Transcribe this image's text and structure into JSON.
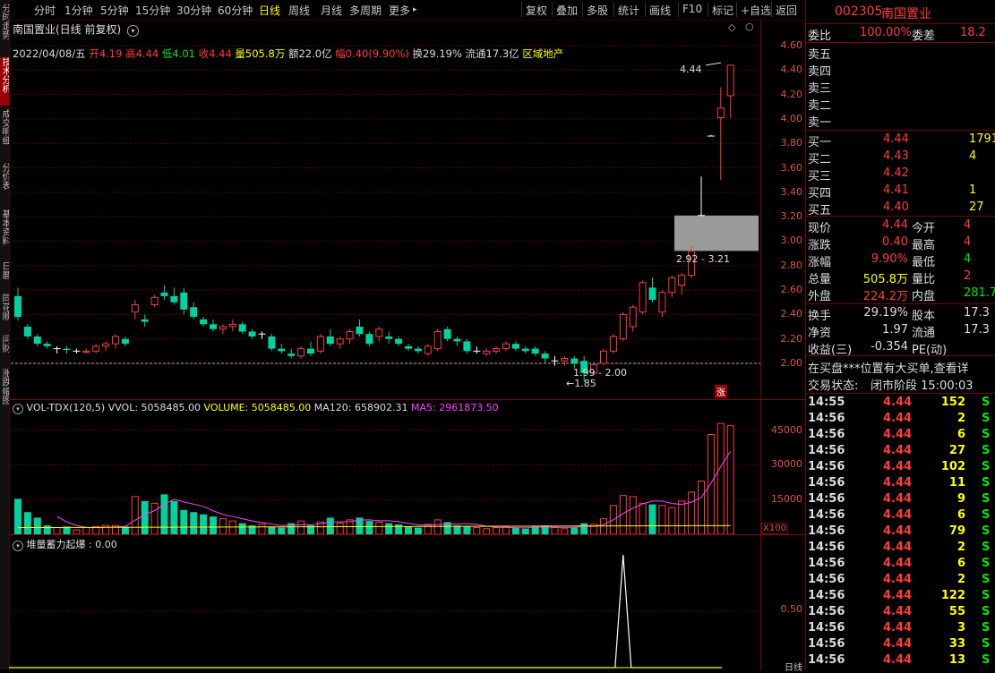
{
  "toolbar": {
    "periods": [
      "分时",
      "1分钟",
      "5分钟",
      "15分钟",
      "30分钟",
      "60分钟",
      "日线",
      "周线",
      "月线",
      "多周期",
      "更多"
    ],
    "active_period": "日线",
    "tools": [
      "复权",
      "叠加",
      "多股",
      "统计",
      "画线",
      "F10",
      "标记",
      "+自选",
      "返回"
    ]
  },
  "side_tabs": [
    "分时走势",
    "技术分析",
    "成交明细",
    "分价表",
    "基本资料",
    "日暦",
    "同花顺",
    "问财",
    "涨跌幅图"
  ],
  "chart": {
    "title": "南国置业(日线 前复权)",
    "date": "2022/04/08/五",
    "open_label": "开",
    "open": "4.19",
    "high_label": "高",
    "high": "4.44",
    "low_label": "低",
    "low": "4.01",
    "close_label": "收",
    "close": "4.44",
    "vol_label": "量",
    "vol": "505.8万",
    "amount_label": "额",
    "amount": "22.0亿",
    "change_label": "幅",
    "change": "0.40(9.90%)",
    "turnover_label": "换",
    "turnover": "29.19%",
    "float_label": "流通",
    "float": "17.3亿",
    "sector": "区域地产",
    "annot_high": "4.44",
    "annot_gap": "2.92 - 3.21",
    "annot_low_range": "1.99 - 2.00",
    "annot_low": "1.85",
    "limit_badge": "涨",
    "price_ticks": [
      "4.60",
      "4.40",
      "4.20",
      "4.00",
      "3.80",
      "3.60",
      "3.40",
      "3.20",
      "3.00",
      "2.80",
      "2.60",
      "2.40",
      "2.20",
      "2.00"
    ]
  },
  "volume": {
    "name": "VOL-TDX(120,5)",
    "vvol": "VVOL: 5058485.00",
    "volume": "VOLUME: 5058485.00",
    "ma120": "MA120: 658902.31",
    "ma5": "MA5: 2961873.50",
    "ticks": [
      "45000",
      "30000",
      "15000"
    ],
    "unit": "X100"
  },
  "indicator": {
    "title": "堆量蓄力起爆 : 0.00",
    "ticks": [
      "0.50"
    ],
    "bottom_label": "日线"
  },
  "chart_data": {
    "type": "candlestick",
    "ohlc": [
      [
        2.55,
        2.62,
        2.35,
        2.38
      ],
      [
        2.3,
        2.32,
        2.2,
        2.22
      ],
      [
        2.22,
        2.24,
        2.14,
        2.16
      ],
      [
        2.16,
        2.18,
        2.12,
        2.14
      ],
      [
        2.12,
        2.14,
        2.08,
        2.12
      ],
      [
        2.12,
        2.14,
        2.08,
        2.11
      ],
      [
        2.1,
        2.12,
        2.08,
        2.1
      ],
      [
        2.09,
        2.12,
        2.08,
        2.1
      ],
      [
        2.1,
        2.16,
        2.08,
        2.14
      ],
      [
        2.14,
        2.18,
        2.1,
        2.16
      ],
      [
        2.16,
        2.24,
        2.12,
        2.22
      ],
      [
        2.2,
        2.22,
        2.14,
        2.16
      ],
      [
        2.42,
        2.52,
        2.36,
        2.48
      ],
      [
        2.36,
        2.4,
        2.3,
        2.34
      ],
      [
        2.48,
        2.56,
        2.46,
        2.54
      ],
      [
        2.58,
        2.64,
        2.52,
        2.55
      ],
      [
        2.55,
        2.62,
        2.48,
        2.5
      ],
      [
        2.58,
        2.62,
        2.4,
        2.44
      ],
      [
        2.46,
        2.5,
        2.36,
        2.38
      ],
      [
        2.36,
        2.38,
        2.3,
        2.32
      ],
      [
        2.32,
        2.36,
        2.26,
        2.28
      ],
      [
        2.28,
        2.32,
        2.24,
        2.3
      ],
      [
        2.3,
        2.36,
        2.26,
        2.32
      ],
      [
        2.32,
        2.34,
        2.24,
        2.26
      ],
      [
        2.26,
        2.28,
        2.2,
        2.22
      ],
      [
        2.24,
        2.26,
        2.2,
        2.24
      ],
      [
        2.22,
        2.24,
        2.1,
        2.12
      ],
      [
        2.12,
        2.16,
        2.08,
        2.1
      ],
      [
        2.08,
        2.12,
        2.04,
        2.06
      ],
      [
        2.06,
        2.14,
        2.04,
        2.12
      ],
      [
        2.12,
        2.18,
        2.06,
        2.08
      ],
      [
        2.1,
        2.24,
        2.08,
        2.22
      ],
      [
        2.22,
        2.28,
        2.14,
        2.16
      ],
      [
        2.16,
        2.22,
        2.12,
        2.2
      ],
      [
        2.2,
        2.28,
        2.16,
        2.26
      ],
      [
        2.3,
        2.36,
        2.22,
        2.24
      ],
      [
        2.24,
        2.26,
        2.14,
        2.16
      ],
      [
        2.22,
        2.3,
        2.18,
        2.28
      ],
      [
        2.22,
        2.26,
        2.16,
        2.2
      ],
      [
        2.2,
        2.22,
        2.14,
        2.16
      ],
      [
        2.14,
        2.16,
        2.1,
        2.12
      ],
      [
        2.12,
        2.14,
        2.08,
        2.1
      ],
      [
        2.08,
        2.16,
        2.06,
        2.14
      ],
      [
        2.12,
        2.28,
        2.1,
        2.26
      ],
      [
        2.28,
        2.3,
        2.18,
        2.2
      ],
      [
        2.2,
        2.22,
        2.14,
        2.18
      ],
      [
        2.18,
        2.2,
        2.08,
        2.1
      ],
      [
        2.1,
        2.14,
        2.08,
        2.1
      ],
      [
        2.08,
        2.12,
        2.06,
        2.1
      ],
      [
        2.1,
        2.14,
        2.08,
        2.12
      ],
      [
        2.12,
        2.18,
        2.1,
        2.16
      ],
      [
        2.16,
        2.18,
        2.1,
        2.12
      ],
      [
        2.12,
        2.14,
        2.08,
        2.1
      ],
      [
        2.12,
        2.14,
        2.06,
        2.08
      ],
      [
        2.08,
        2.1,
        2.0,
        2.04
      ],
      [
        2.02,
        2.06,
        1.98,
        2.02
      ],
      [
        2.02,
        2.06,
        1.98,
        2.04
      ],
      [
        2.04,
        2.06,
        1.96,
        2.0
      ],
      [
        2.02,
        2.06,
        1.85,
        1.92
      ],
      [
        1.92,
        2.0,
        1.9,
        1.99
      ],
      [
        2.0,
        2.12,
        1.98,
        2.1
      ],
      [
        2.1,
        2.24,
        2.08,
        2.22
      ],
      [
        2.2,
        2.42,
        2.18,
        2.4
      ],
      [
        2.3,
        2.48,
        2.26,
        2.46
      ],
      [
        2.42,
        2.68,
        2.4,
        2.66
      ],
      [
        2.62,
        2.7,
        2.5,
        2.52
      ],
      [
        2.42,
        2.6,
        2.38,
        2.58
      ],
      [
        2.58,
        2.72,
        2.54,
        2.7
      ],
      [
        2.64,
        2.74,
        2.56,
        2.72
      ],
      [
        2.72,
        2.96,
        2.7,
        2.92
      ],
      [
        3.21,
        3.53,
        3.21,
        3.21
      ],
      [
        3.86,
        3.87,
        3.86,
        3.86
      ],
      [
        4.01,
        4.26,
        3.5,
        4.09
      ],
      [
        4.19,
        4.44,
        4.01,
        4.44
      ]
    ],
    "volume": [
      320,
      200,
      150,
      80,
      60,
      70,
      40,
      60,
      70,
      80,
      80,
      70,
      340,
      300,
      280,
      360,
      300,
      220,
      200,
      180,
      160,
      140,
      120,
      100,
      80,
      90,
      70,
      60,
      100,
      120,
      80,
      110,
      150,
      100,
      130,
      150,
      120,
      110,
      100,
      90,
      70,
      60,
      90,
      130,
      110,
      80,
      70,
      60,
      50,
      60,
      70,
      60,
      50,
      70,
      80,
      60,
      50,
      60,
      100,
      90,
      140,
      260,
      350,
      340,
      280,
      270,
      260,
      240,
      300,
      380,
      480,
      900,
      1000,
      980
    ],
    "ma120_level": 0.05,
    "indicator_spike_index": 62,
    "indicator_spike_value": 1.0
  },
  "quote": {
    "code": "002305",
    "name": "南国置业",
    "weibi_label": "委比",
    "weibi": "100.00%",
    "weicha_label": "委差",
    "weicha": "18.2",
    "asks": [
      {
        "label": "卖五",
        "price": "",
        "vol": ""
      },
      {
        "label": "卖四",
        "price": "",
        "vol": ""
      },
      {
        "label": "卖三",
        "price": "",
        "vol": ""
      },
      {
        "label": "卖二",
        "price": "",
        "vol": ""
      },
      {
        "label": "卖一",
        "price": "",
        "vol": ""
      }
    ],
    "bids": [
      {
        "label": "买一",
        "price": "4.44",
        "vol": "1791"
      },
      {
        "label": "买二",
        "price": "4.43",
        "vol": "4"
      },
      {
        "label": "买三",
        "price": "4.42",
        "vol": ""
      },
      {
        "label": "买四",
        "price": "4.41",
        "vol": "1"
      },
      {
        "label": "买五",
        "price": "4.40",
        "vol": "27"
      }
    ],
    "stats": [
      {
        "l1": "现价",
        "v1": "4.44",
        "l2": "今开",
        "v2": "4"
      },
      {
        "l1": "涨跌",
        "v1": "0.40",
        "l2": "最高",
        "v2": "4"
      },
      {
        "l1": "涨幅",
        "v1": "9.90%",
        "l2": "最低",
        "v2": "4"
      },
      {
        "l1": "总量",
        "v1": "505.8万",
        "l2": "量比",
        "v2": "2"
      },
      {
        "l1": "外盘",
        "v1": "224.2万",
        "l2": "内盘",
        "v2": "281.7"
      }
    ],
    "stats2": [
      {
        "l1": "换手",
        "v1": "29.19%",
        "l2": "股本",
        "v2": "17.3"
      },
      {
        "l1": "净资",
        "v1": "1.97",
        "l2": "流通",
        "v2": "17.3"
      },
      {
        "l1": "收益(三)",
        "v1": "-0.354",
        "l2": "PE(动)",
        "v2": ""
      }
    ],
    "notice": "在买盘***位置有大买单,查看详",
    "status_label": "交易状态:",
    "status": "闭市阶段 15:00:03",
    "ticks": [
      {
        "t": "14:55",
        "p": "4.44",
        "v": "152",
        "s": "S"
      },
      {
        "t": "14:56",
        "p": "4.44",
        "v": "2",
        "s": "S"
      },
      {
        "t": "14:56",
        "p": "4.44",
        "v": "6",
        "s": "S"
      },
      {
        "t": "14:56",
        "p": "4.44",
        "v": "27",
        "s": "S"
      },
      {
        "t": "14:56",
        "p": "4.44",
        "v": "102",
        "s": "S"
      },
      {
        "t": "14:56",
        "p": "4.44",
        "v": "11",
        "s": "S"
      },
      {
        "t": "14:56",
        "p": "4.44",
        "v": "9",
        "s": "S"
      },
      {
        "t": "14:56",
        "p": "4.44",
        "v": "6",
        "s": "S"
      },
      {
        "t": "14:56",
        "p": "4.44",
        "v": "79",
        "s": "S"
      },
      {
        "t": "14:56",
        "p": "4.44",
        "v": "2",
        "s": "S"
      },
      {
        "t": "14:56",
        "p": "4.44",
        "v": "6",
        "s": "S"
      },
      {
        "t": "14:56",
        "p": "4.44",
        "v": "2",
        "s": "S"
      },
      {
        "t": "14:56",
        "p": "4.44",
        "v": "122",
        "s": "S"
      },
      {
        "t": "14:56",
        "p": "4.44",
        "v": "55",
        "s": "S"
      },
      {
        "t": "14:56",
        "p": "4.44",
        "v": "3",
        "s": "S"
      },
      {
        "t": "14:56",
        "p": "4.44",
        "v": "33",
        "s": "S"
      },
      {
        "t": "14:56",
        "p": "4.44",
        "v": "13",
        "s": "S"
      }
    ]
  },
  "colors": {
    "up": "#ff3c3c",
    "down": "#00d2a0",
    "grid": "#6a0000",
    "ma5": "#ff40ff",
    "ma120": "#ffff00"
  }
}
